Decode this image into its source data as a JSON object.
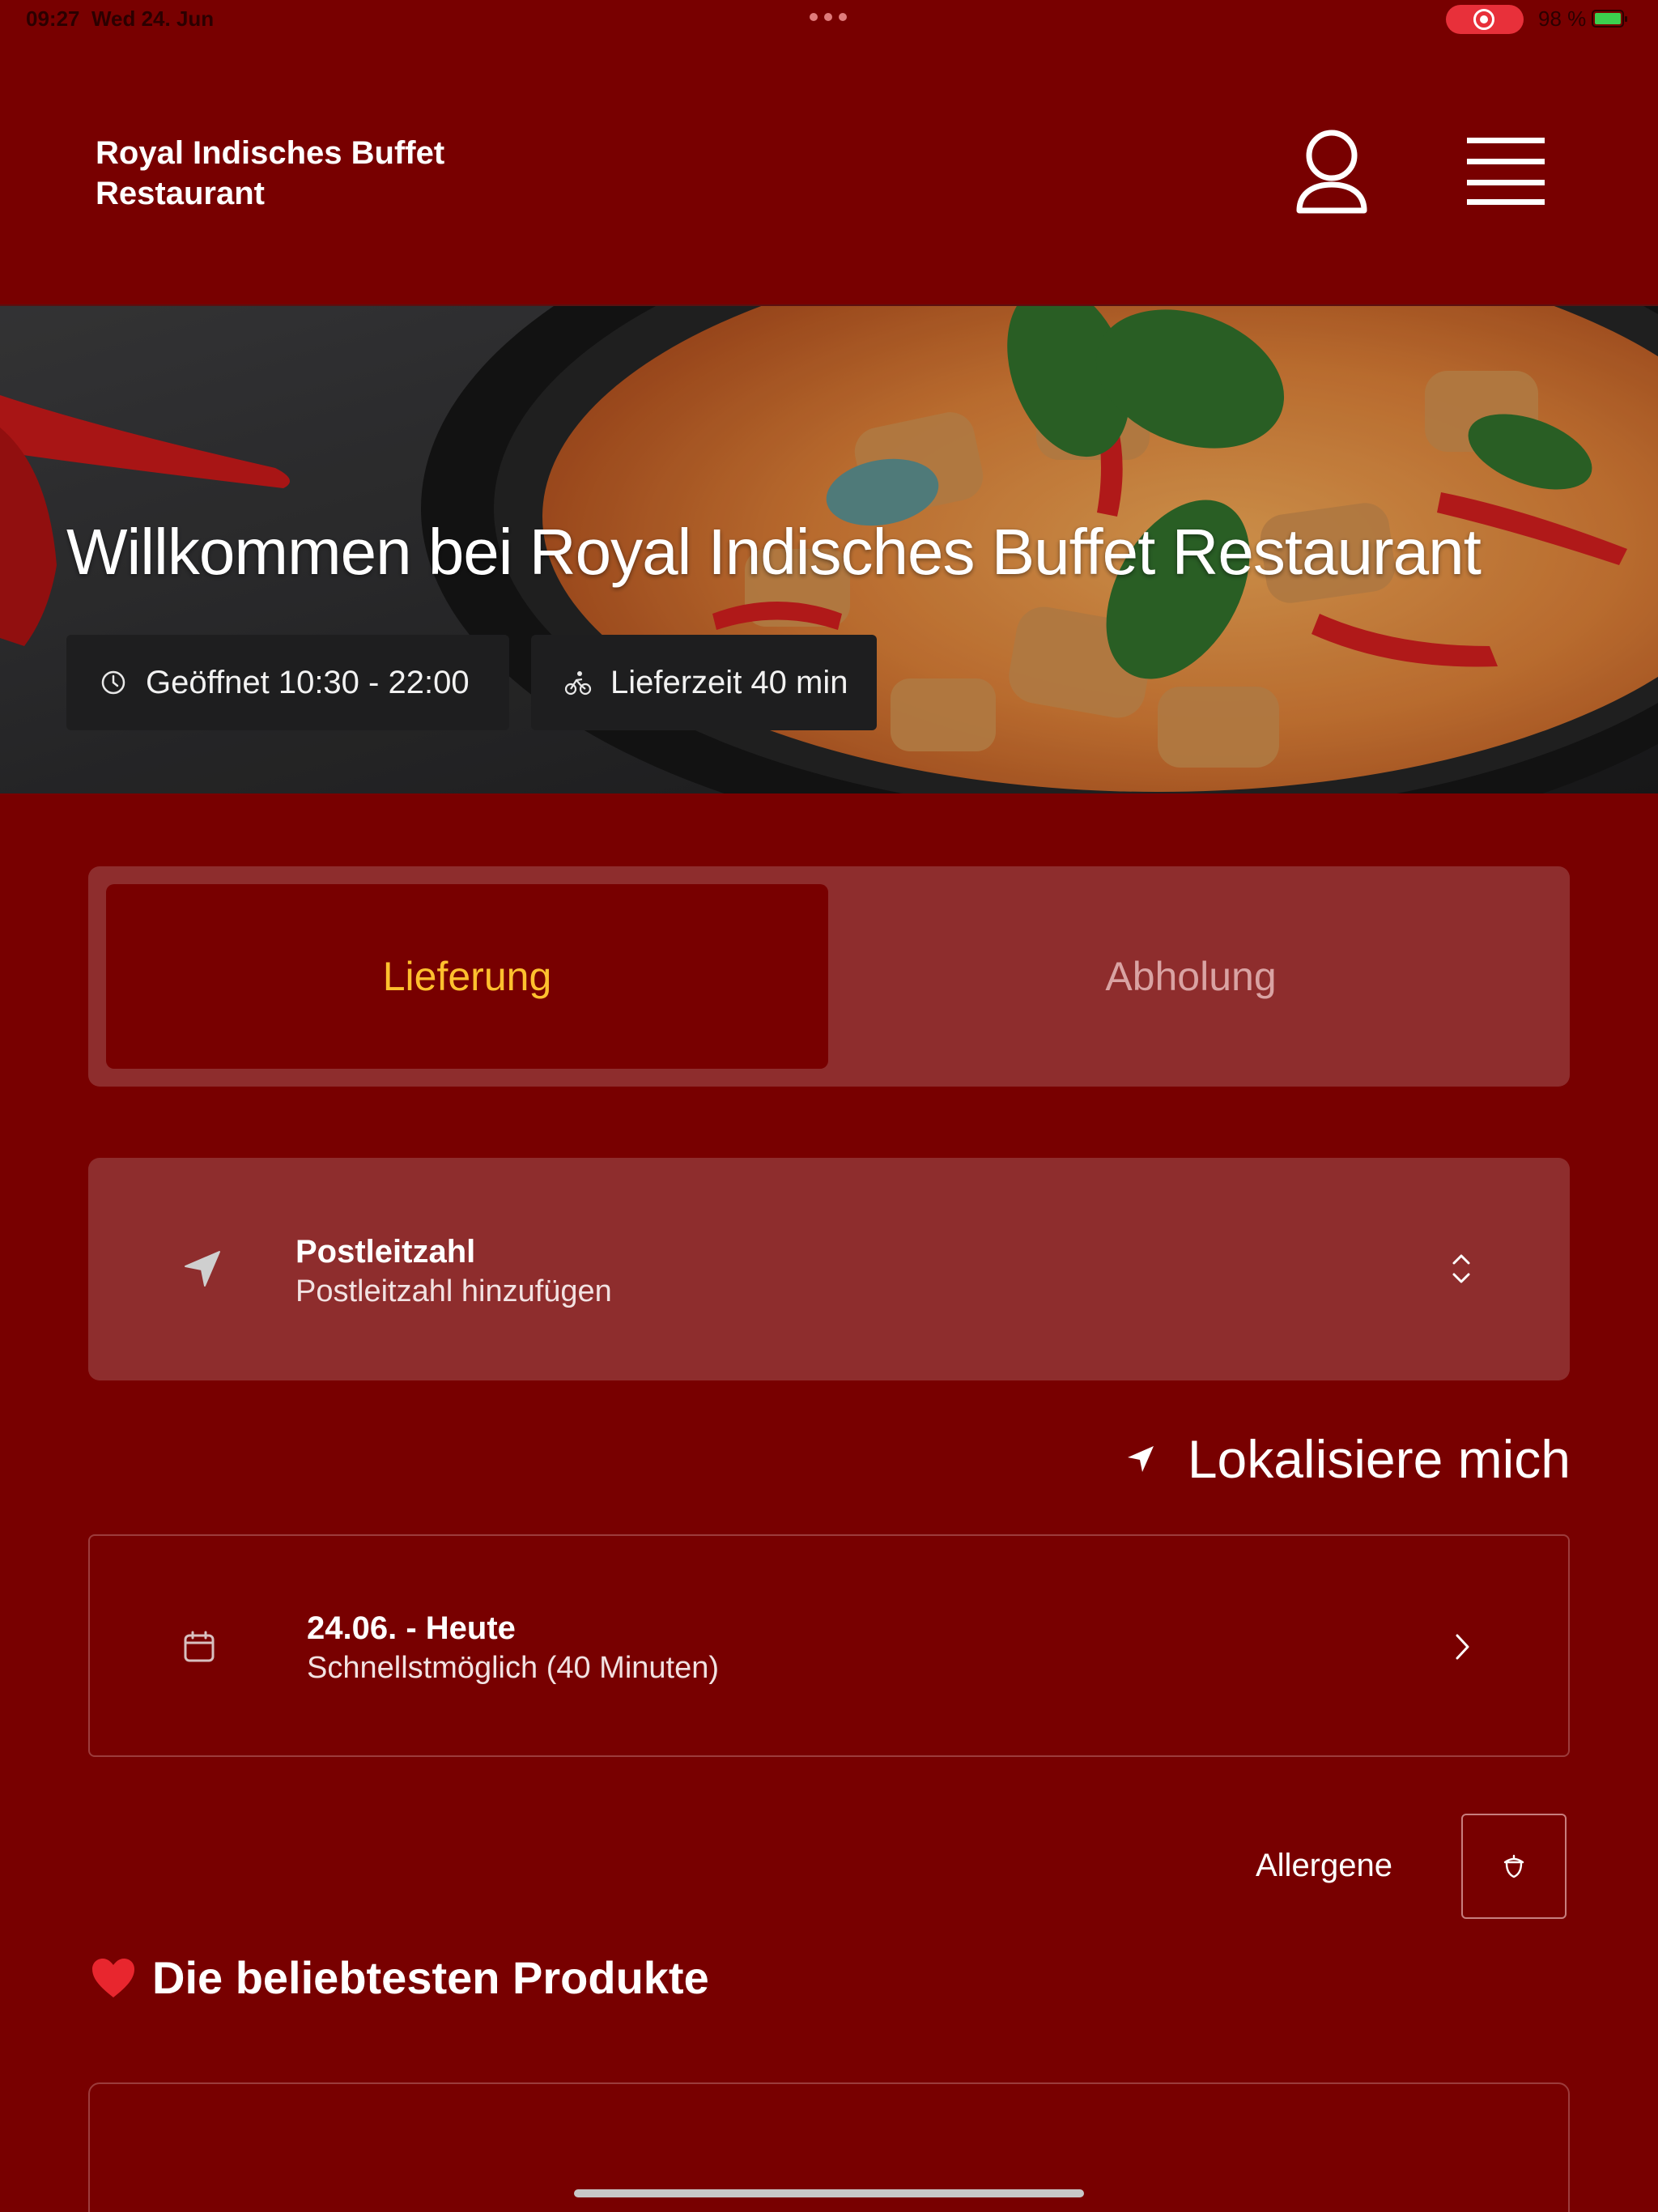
{
  "status_bar": {
    "time": "09:27",
    "date": "Wed 24. Jun",
    "battery": "98 %"
  },
  "header": {
    "brand": "Royal Indisches Buffet Restaurant",
    "icons": {
      "user": "user-icon",
      "menu": "hamburger-menu-icon"
    }
  },
  "hero": {
    "title": "Willkommen bei Royal Indisches Buffet Restaurant",
    "opening_hours": "Geöffnet 10:30 - 22:00",
    "delivery_time": "Lieferzeit 40 min",
    "icons": {
      "clock": "clock-icon",
      "bike": "bike-icon"
    }
  },
  "mode_toggle": {
    "delivery": "Lieferung",
    "pickup": "Abholung",
    "selected": "delivery"
  },
  "postcode": {
    "title": "Postleitzahl",
    "placeholder": "Postleitzahl hinzufügen"
  },
  "locate": {
    "label": "Lokalisiere mich"
  },
  "schedule": {
    "date": "24.06. - Heute",
    "detail": "Schnellstmöglich (40 Minuten)"
  },
  "allergens": {
    "label": "Allergene"
  },
  "section": {
    "title": "Die beliebtesten Produkte"
  },
  "colors": {
    "background": "#780000",
    "panel": "#8e2d2d",
    "accent": "#ffc02e",
    "chip": "#1e1e1f"
  }
}
